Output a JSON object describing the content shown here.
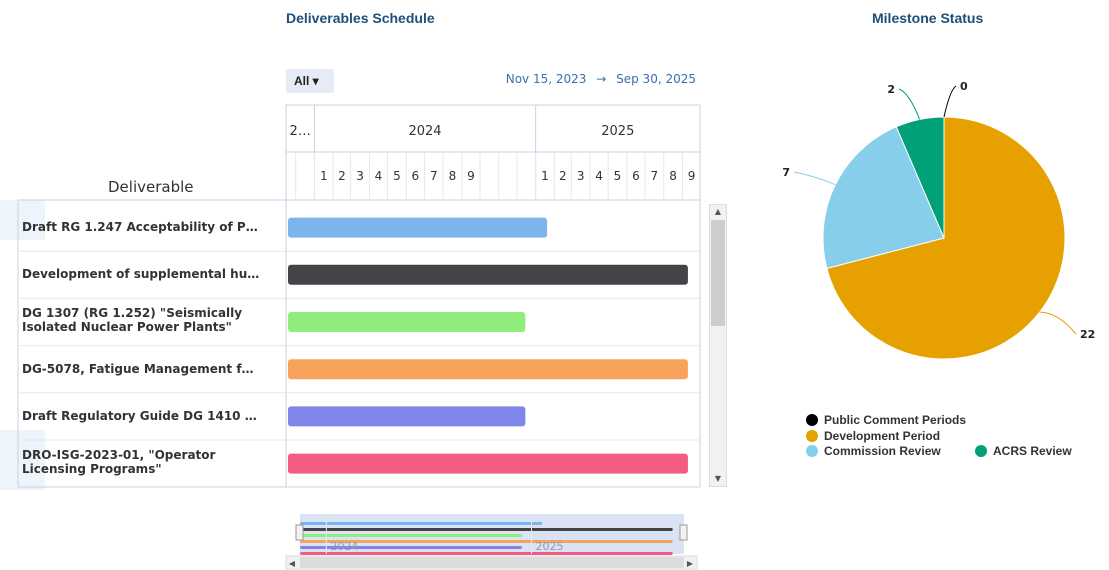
{
  "titles": {
    "gantt": "Deliverables Schedule",
    "pie": "Milestone Status"
  },
  "filter": {
    "label": "All ▾"
  },
  "date_range": {
    "start": "Nov 15, 2023",
    "arrow": "→",
    "end": "Sep 30, 2025"
  },
  "gantt": {
    "column_header": "Deliverable",
    "year_labels": [
      "2…",
      "2024",
      "2025"
    ],
    "month_labels_2024": [
      "1",
      "2",
      "3",
      "4",
      "5",
      "6",
      "7",
      "8",
      "9"
    ],
    "month_labels_2025": [
      "1",
      "2",
      "3",
      "4",
      "5",
      "6",
      "7",
      "8",
      "9"
    ],
    "navigator_years": [
      "2024",
      "2025"
    ]
  },
  "chart_data": [
    {
      "type": "bar",
      "subtype": "gantt",
      "title": "Deliverables Schedule",
      "x_range": [
        "2023-11-15",
        "2025-09-30"
      ],
      "categories": [
        "Draft RG 1.247 Acceptability of P…",
        "Development of supplemental hu…",
        "DG 1307 (RG 1.252) \"Seismically Isolated Nuclear Power Plants\"",
        "DG-5078, Fatigue Management f…",
        "Draft Regulatory Guide DG 1410 …",
        "DRO-ISG-2023-01, \"Operator Licensing Programs\""
      ],
      "tasks": [
        {
          "name": "Draft RG 1.247 Acceptability of P…",
          "start": "2023-11-15",
          "end": "2025-01-20",
          "color": "#7cb5ec"
        },
        {
          "name": "Development of supplemental hu…",
          "start": "2023-11-15",
          "end": "2025-09-10",
          "color": "#434348"
        },
        {
          "name": "DG 1307 (RG 1.252) \"Seismically Isolated Nuclear Power Plants\"",
          "start": "2023-11-15",
          "end": "2024-12-15",
          "color": "#90ed7d"
        },
        {
          "name": "DG-5078, Fatigue Management f…",
          "start": "2023-11-15",
          "end": "2025-09-10",
          "color": "#f7a35c"
        },
        {
          "name": "Draft Regulatory Guide DG 1410 …",
          "start": "2023-11-15",
          "end": "2024-12-15",
          "color": "#8085e9"
        },
        {
          "name": "DRO-ISG-2023-01, \"Operator Licensing Programs\"",
          "start": "2023-11-15",
          "end": "2025-09-10",
          "color": "#f15c80"
        }
      ]
    },
    {
      "type": "pie",
      "title": "Milestone Status",
      "series": [
        {
          "name": "Public Comment Periods",
          "value": 0,
          "color": "#000000"
        },
        {
          "name": "Development Period",
          "value": 22,
          "color": "#e6a100"
        },
        {
          "name": "Commission Review",
          "value": 7,
          "color": "#87ceeb"
        },
        {
          "name": "ACRS Review",
          "value": 2,
          "color": "#00a078"
        }
      ],
      "legend_position": "bottom"
    }
  ]
}
